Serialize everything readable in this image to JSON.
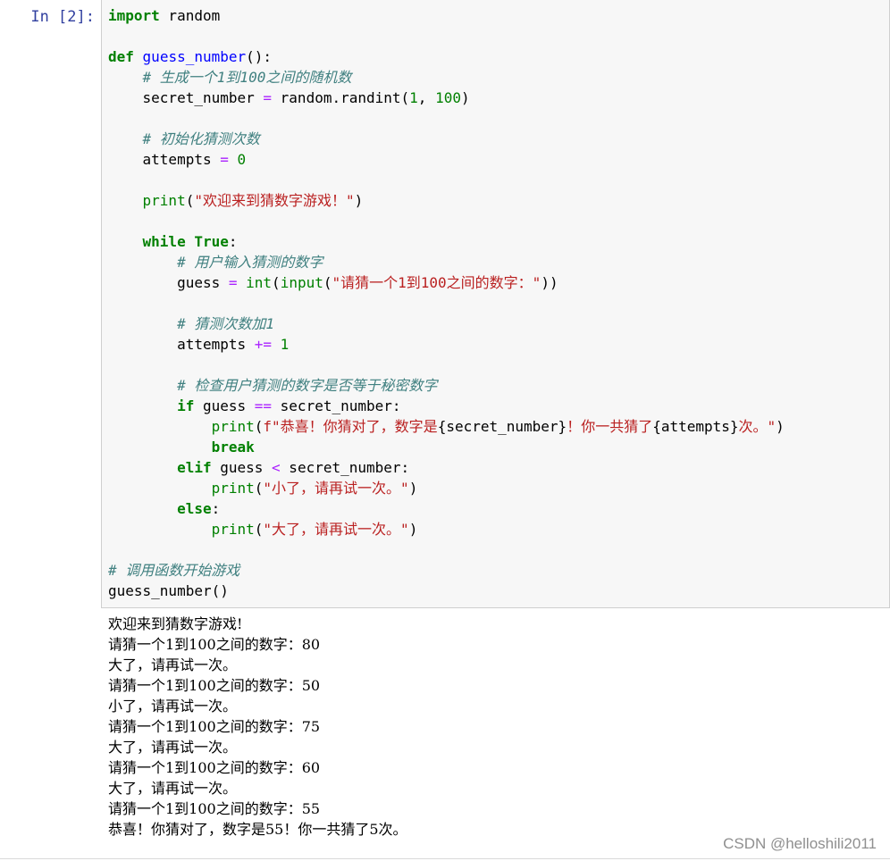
{
  "cell": {
    "prompt": "In  [2]:",
    "code": [
      [
        [
          "kw",
          "import"
        ],
        [
          "t",
          " random"
        ]
      ],
      [],
      [
        [
          "kw",
          "def"
        ],
        [
          "t",
          " "
        ],
        [
          "fn",
          "guess_number"
        ],
        [
          "t",
          "():"
        ]
      ],
      [
        [
          "t",
          "    "
        ],
        [
          "cm",
          "# 生成一个1到100之间的随机数"
        ]
      ],
      [
        [
          "t",
          "    secret_number "
        ],
        [
          "op",
          "="
        ],
        [
          "t",
          " random.randint("
        ],
        [
          "num",
          "1"
        ],
        [
          "t",
          ", "
        ],
        [
          "num",
          "100"
        ],
        [
          "t",
          ")"
        ]
      ],
      [],
      [
        [
          "t",
          "    "
        ],
        [
          "cm",
          "# 初始化猜测次数"
        ]
      ],
      [
        [
          "t",
          "    attempts "
        ],
        [
          "op",
          "="
        ],
        [
          "t",
          " "
        ],
        [
          "num",
          "0"
        ]
      ],
      [],
      [
        [
          "t",
          "    "
        ],
        [
          "bi",
          "print"
        ],
        [
          "t",
          "("
        ],
        [
          "str",
          "\"欢迎来到猜数字游戏！\""
        ],
        [
          "t",
          ")"
        ]
      ],
      [],
      [
        [
          "t",
          "    "
        ],
        [
          "kw",
          "while"
        ],
        [
          "t",
          " "
        ],
        [
          "kw",
          "True"
        ],
        [
          "t",
          ":"
        ]
      ],
      [
        [
          "t",
          "        "
        ],
        [
          "cm",
          "# 用户输入猜测的数字"
        ]
      ],
      [
        [
          "t",
          "        guess "
        ],
        [
          "op",
          "="
        ],
        [
          "t",
          " "
        ],
        [
          "bi",
          "int"
        ],
        [
          "t",
          "("
        ],
        [
          "bi",
          "input"
        ],
        [
          "t",
          "("
        ],
        [
          "str",
          "\"请猜一个1到100之间的数字：\""
        ],
        [
          "t",
          "))"
        ]
      ],
      [],
      [
        [
          "t",
          "        "
        ],
        [
          "cm",
          "# 猜测次数加1"
        ]
      ],
      [
        [
          "t",
          "        attempts "
        ],
        [
          "op",
          "+="
        ],
        [
          "t",
          " "
        ],
        [
          "num",
          "1"
        ]
      ],
      [],
      [
        [
          "t",
          "        "
        ],
        [
          "cm",
          "# 检查用户猜测的数字是否等于秘密数字"
        ]
      ],
      [
        [
          "t",
          "        "
        ],
        [
          "kw",
          "if"
        ],
        [
          "t",
          " guess "
        ],
        [
          "op",
          "=="
        ],
        [
          "t",
          " secret_number:"
        ]
      ],
      [
        [
          "t",
          "            "
        ],
        [
          "bi",
          "print"
        ],
        [
          "t",
          "("
        ],
        [
          "str",
          "f\"恭喜！你猜对了，数字是"
        ],
        [
          "t",
          "{secret_number}"
        ],
        [
          "str",
          "！你一共猜了"
        ],
        [
          "t",
          "{attempts}"
        ],
        [
          "str",
          "次。\""
        ],
        [
          "t",
          ")"
        ]
      ],
      [
        [
          "t",
          "            "
        ],
        [
          "kw",
          "break"
        ]
      ],
      [
        [
          "t",
          "        "
        ],
        [
          "kw",
          "elif"
        ],
        [
          "t",
          " guess "
        ],
        [
          "op",
          "<"
        ],
        [
          "t",
          " secret_number:"
        ]
      ],
      [
        [
          "t",
          "            "
        ],
        [
          "bi",
          "print"
        ],
        [
          "t",
          "("
        ],
        [
          "str",
          "\"小了，请再试一次。\""
        ],
        [
          "t",
          ")"
        ]
      ],
      [
        [
          "t",
          "        "
        ],
        [
          "kw",
          "else"
        ],
        [
          "t",
          ":"
        ]
      ],
      [
        [
          "t",
          "            "
        ],
        [
          "bi",
          "print"
        ],
        [
          "t",
          "("
        ],
        [
          "str",
          "\"大了，请再试一次。\""
        ],
        [
          "t",
          ")"
        ]
      ],
      [],
      [
        [
          "cm",
          "# 调用函数开始游戏"
        ]
      ],
      [
        [
          "t",
          "guess_number()"
        ]
      ]
    ]
  },
  "output": [
    "欢迎来到猜数字游戏!",
    "请猜一个1到100之间的数字：80",
    "大了，请再试一次。",
    "请猜一个1到100之间的数字：50",
    "小了，请再试一次。",
    "请猜一个1到100之间的数字：75",
    "大了，请再试一次。",
    "请猜一个1到100之间的数字：60",
    "大了，请再试一次。",
    "请猜一个1到100之间的数字：55",
    "恭喜！你猜对了，数字是55！你一共猜了5次。"
  ],
  "watermark": "CSDN @helloshili2011",
  "colors": {
    "keyword": "#008000",
    "function_name": "#0000ff",
    "string": "#ba2121",
    "comment": "#408080",
    "operator": "#aa22ff",
    "prompt": "#303f9f"
  }
}
